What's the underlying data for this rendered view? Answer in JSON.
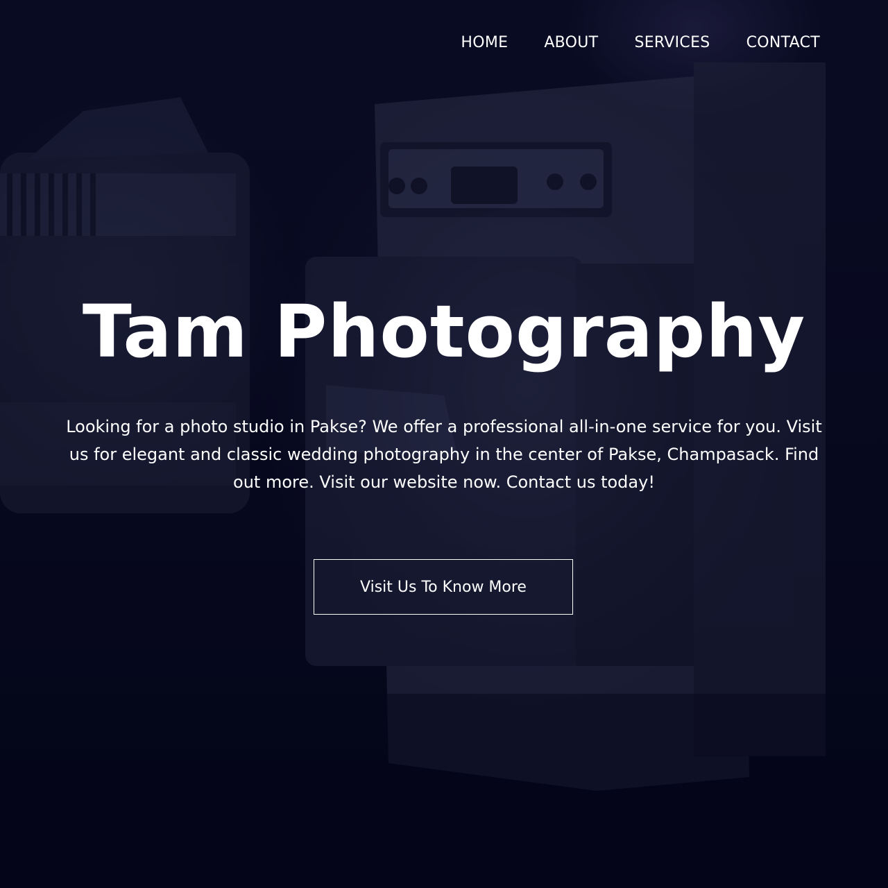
{
  "nav": {
    "items": [
      {
        "label": "HOME"
      },
      {
        "label": "ABOUT"
      },
      {
        "label": "SERVICES"
      },
      {
        "label": "CONTACT"
      }
    ]
  },
  "hero": {
    "title": "Tam Photography",
    "description": "Looking for a photo studio in Pakse? We offer a professional all-in-one service for you. Visit us for elegant and classic wedding photography in the center of Pakse, Champasack. Find out more. Visit our website now. Contact us today!",
    "cta_label": "Visit Us To Know More",
    "background_image": "camera-photo"
  },
  "colors": {
    "overlay": "#05061a",
    "text": "#ffffff"
  }
}
